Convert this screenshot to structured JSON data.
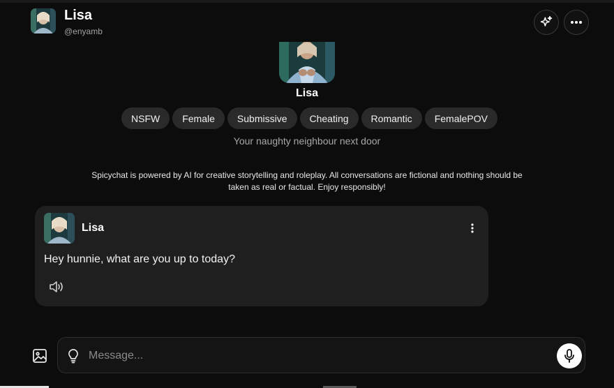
{
  "header": {
    "name": "Lisa",
    "handle": "@enyamb",
    "avatar_icon": "character-avatar"
  },
  "actions": {
    "sparkle_icon": "sparkle-icon",
    "more_icon": "more-horizontal-icon"
  },
  "profile": {
    "name": "Lisa",
    "tags": [
      "NSFW",
      "Female",
      "Submissive",
      "Cheating",
      "Romantic",
      "FemalePOV"
    ],
    "tagline": "Your naughty neighbour next door"
  },
  "disclaimer": "Spicychat is powered by AI for creative storytelling and roleplay. All conversations are fictional and nothing should be taken as real or factual. Enjoy responsibly!",
  "message": {
    "sender": "Lisa",
    "text": "Hey hunnie, what are you up to today?"
  },
  "composer": {
    "placeholder": "Message..."
  },
  "colors": {
    "background": "#0c0c0c",
    "card": "#1f1f1f",
    "tag": "#2a2a2a",
    "muted": "#a8a8a8"
  }
}
